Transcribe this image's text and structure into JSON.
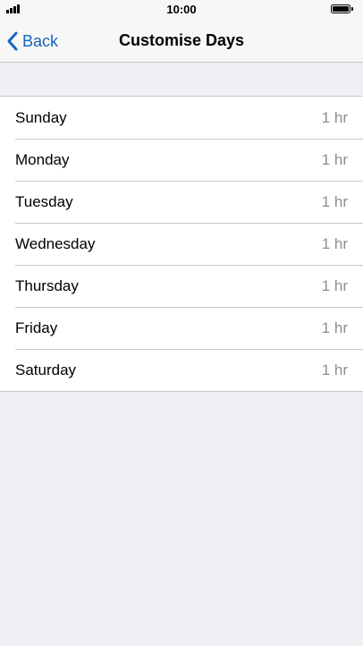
{
  "status_bar": {
    "time": "10:00"
  },
  "nav": {
    "back_label": "Back",
    "title": "Customise Days"
  },
  "days": [
    {
      "label": "Sunday",
      "value": "1 hr"
    },
    {
      "label": "Monday",
      "value": "1 hr"
    },
    {
      "label": "Tuesday",
      "value": "1 hr"
    },
    {
      "label": "Wednesday",
      "value": "1 hr"
    },
    {
      "label": "Thursday",
      "value": "1 hr"
    },
    {
      "label": "Friday",
      "value": "1 hr"
    },
    {
      "label": "Saturday",
      "value": "1 hr"
    }
  ],
  "colors": {
    "accent": "#1565c0",
    "background": "#efeff4",
    "secondary_text": "#8e8e93"
  },
  "icons": {
    "signal": "signal-icon",
    "battery": "battery-icon",
    "back": "chevron-left-icon"
  }
}
